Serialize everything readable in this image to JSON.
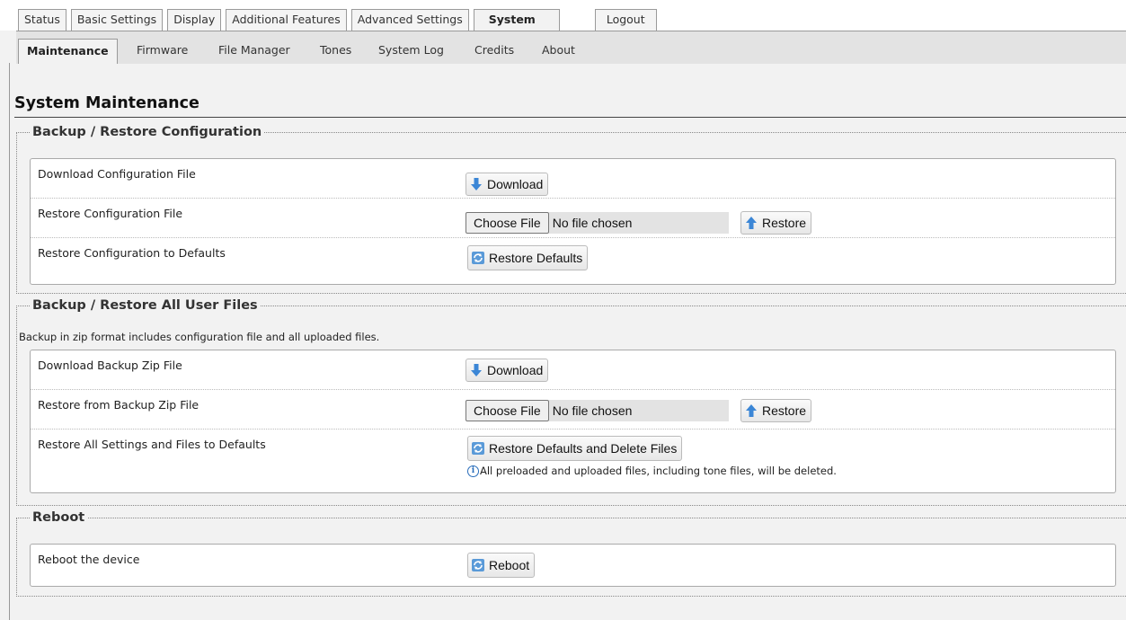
{
  "top_tabs": [
    {
      "label": "Status"
    },
    {
      "label": "Basic Settings"
    },
    {
      "label": "Display"
    },
    {
      "label": "Additional Features"
    },
    {
      "label": "Advanced Settings"
    },
    {
      "label": "System",
      "active": true
    },
    {
      "label": "Logout"
    }
  ],
  "sub_tabs": [
    {
      "label": "Maintenance",
      "active": true
    },
    {
      "label": "Firmware"
    },
    {
      "label": "File Manager"
    },
    {
      "label": "Tones"
    },
    {
      "label": "System Log"
    },
    {
      "label": "Credits"
    },
    {
      "label": "About"
    }
  ],
  "page_title": "System Maintenance",
  "config_section": {
    "legend": "Backup / Restore Configuration",
    "rows": [
      {
        "label": "Download Configuration File",
        "button": "Download",
        "icon": "download-icon"
      },
      {
        "label": "Restore Configuration File",
        "choose_label": "Choose File",
        "file_status": "No file chosen",
        "button": "Restore",
        "icon": "upload-icon"
      },
      {
        "label": "Restore Configuration to Defaults",
        "button": "Restore Defaults",
        "icon": "refresh-icon"
      }
    ]
  },
  "user_files_section": {
    "legend": "Backup / Restore All User Files",
    "note": "Backup in zip format includes configuration file and all uploaded files.",
    "rows": [
      {
        "label": "Download Backup Zip File",
        "button": "Download",
        "icon": "download-icon"
      },
      {
        "label": "Restore from Backup Zip File",
        "choose_label": "Choose File",
        "file_status": "No file chosen",
        "button": "Restore",
        "icon": "upload-icon"
      },
      {
        "label": "Restore All Settings and Files to Defaults",
        "button": "Restore Defaults and Delete Files",
        "icon": "refresh-icon",
        "info_icon": "info-icon",
        "info_text": "All preloaded and uploaded files, including tone files, will be deleted."
      }
    ]
  },
  "reboot_section": {
    "legend": "Reboot",
    "rows": [
      {
        "label": "Reboot the device",
        "button": "Reboot",
        "icon": "refresh-icon"
      }
    ]
  },
  "colors": {
    "accent_blue": "#2a6ebb",
    "icon_blue": "#3b86d6",
    "page_bg": "#f2f2f2"
  }
}
